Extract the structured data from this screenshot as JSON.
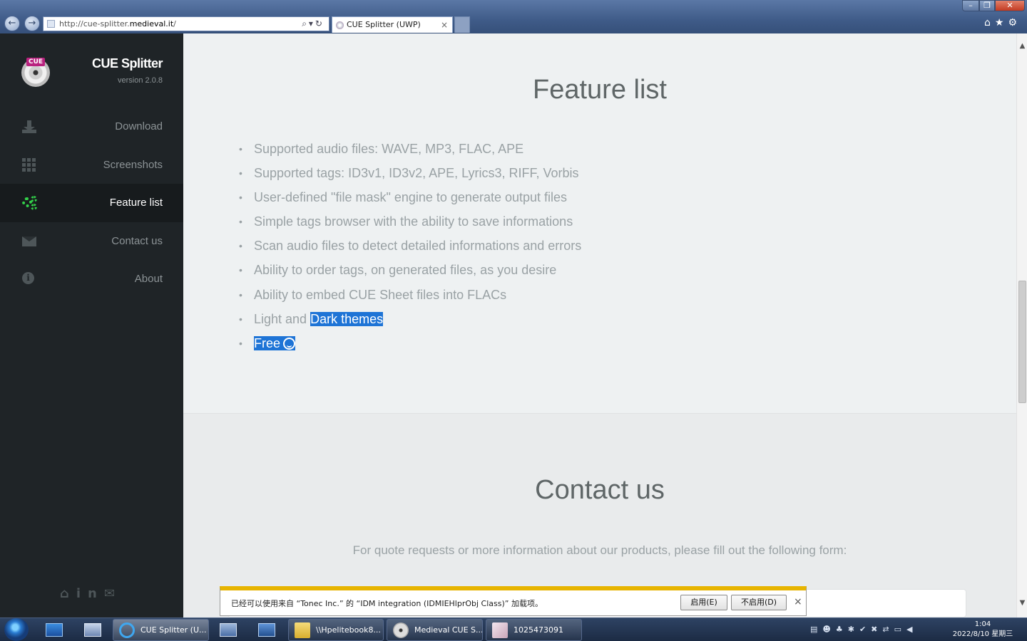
{
  "browser": {
    "url_prefix": "http://cue-splitter.",
    "url_host": "medieval.it",
    "url_suffix": "/",
    "tab_title": "CUE Splitter (UWP)",
    "tab_close": "×",
    "back": "←",
    "forward": "→",
    "addr_controls": "⌕▾↻",
    "toolbar_icons": "⌂★⚙",
    "win_min": "–",
    "win_max": "❐",
    "win_close": "✕"
  },
  "sidebar": {
    "logo_badge": "CUE",
    "app_name": "CUE Splitter",
    "version": "version 2.0.8",
    "items": [
      {
        "label": "Download",
        "icon": "download-icon"
      },
      {
        "label": "Screenshots",
        "icon": "grid-icon"
      },
      {
        "label": "Feature list",
        "icon": "gears-icon",
        "active": true
      },
      {
        "label": "Contact us",
        "icon": "mail-icon"
      },
      {
        "label": "About",
        "icon": "info-icon"
      }
    ],
    "info_glyph": "i",
    "social": {
      "home": "⌂",
      "linkedin": "in",
      "mail": "✉"
    }
  },
  "features": {
    "title": "Feature list",
    "items": [
      "Supported audio files: WAVE, MP3, FLAC, APE",
      "Supported tags: ID3v1, ID3v2, APE, Lyrics3, RIFF, Vorbis",
      "User-defined \"file mask\" engine to generate output files",
      "Simple tags browser with the ability to save informations",
      "Scan audio files to detect detailed informations and errors",
      "Ability to order tags, on generated files, as you desire",
      "Ability to embed CUE Sheet files into FLACs"
    ],
    "themes_prefix": "Light and ",
    "themes_selected": "Dark themes",
    "free": "Free"
  },
  "contact": {
    "title": "Contact us",
    "description": "For quote requests or more information about our products, please fill out the following form:"
  },
  "notification": {
    "message": "已经可以使用来自 “Tonec Inc.” 的 “IDM integration (IDMIEHlprObj Class)” 加载项。",
    "enable": "启用(E)",
    "disable": "不启用(D)",
    "close": "×"
  },
  "scrollbar": {
    "up": "▲",
    "down": "▼"
  },
  "taskbar": {
    "tasks": [
      {
        "label": "CUE Splitter (U...",
        "active": true
      },
      {
        "label": "\\\\Hpelitebook8...",
        "active": false
      },
      {
        "label": "Medieval CUE S...",
        "active": false
      },
      {
        "label": "1025473091",
        "active": false
      }
    ],
    "tray_icons": "▤☻♣✱✔✖⇄▭◀",
    "time": "1:04",
    "date": "2022/8/10 星期三"
  },
  "colors": {
    "sidebar_bg": "#1f2427",
    "active_icon": "#33d14a",
    "selection": "#1e74d6",
    "notif_accent": "#e7b400"
  }
}
